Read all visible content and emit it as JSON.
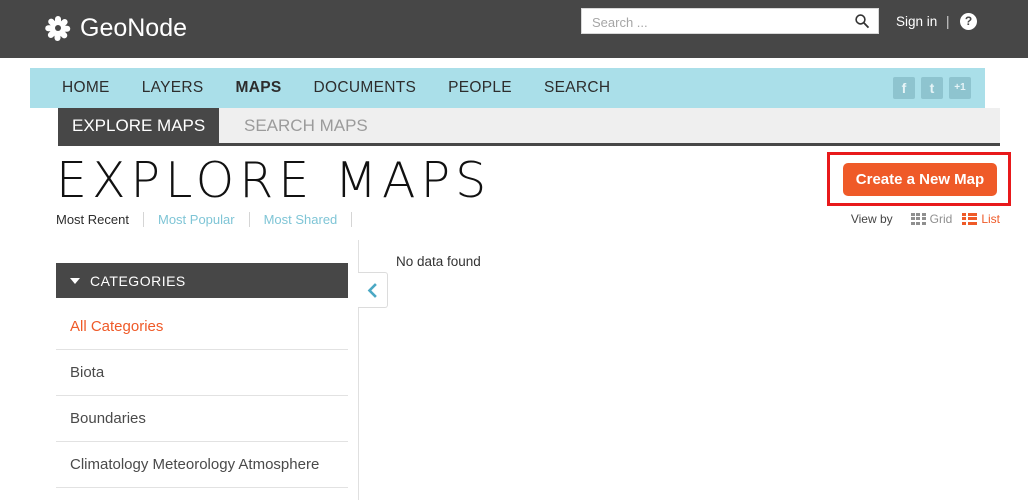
{
  "header": {
    "brand": "GeoNode",
    "brand_logo_icon": "geonode-flower-icon",
    "search": {
      "placeholder": "Search ...",
      "value": "",
      "icon": "search-icon"
    },
    "signin_label": "Sign in",
    "divider": "|",
    "help_icon_label": "?"
  },
  "nav": {
    "items": [
      {
        "label": "HOME",
        "active": false
      },
      {
        "label": "LAYERS",
        "active": false
      },
      {
        "label": "MAPS",
        "active": true
      },
      {
        "label": "DOCUMENTS",
        "active": false
      },
      {
        "label": "PEOPLE",
        "active": false
      },
      {
        "label": "SEARCH",
        "active": false
      }
    ],
    "social": [
      {
        "name": "facebook-icon",
        "glyph": "f"
      },
      {
        "name": "twitter-icon",
        "glyph": "t"
      },
      {
        "name": "google-plus-icon",
        "glyph": "+1"
      }
    ]
  },
  "tabs": [
    {
      "label": "EXPLORE MAPS",
      "active": true
    },
    {
      "label": "SEARCH MAPS",
      "active": false
    }
  ],
  "page": {
    "title": "EXPLORE MAPS",
    "sort_options": [
      {
        "label": "Most Recent",
        "active": true
      },
      {
        "label": "Most Popular",
        "active": false
      },
      {
        "label": "Most Shared",
        "active": false
      }
    ],
    "create_button": "Create a New Map",
    "view_by_label": "View by",
    "view_options": [
      {
        "label": "Grid",
        "icon": "grid-icon",
        "active": false
      },
      {
        "label": "List",
        "icon": "list-icon",
        "active": true
      }
    ]
  },
  "sidebar": {
    "header": "CATEGORIES",
    "header_icon": "chevron-down-icon",
    "items": [
      {
        "label": "All Categories",
        "active": true
      },
      {
        "label": "Biota",
        "active": false
      },
      {
        "label": "Boundaries",
        "active": false
      },
      {
        "label": "Climatology Meteorology Atmosphere",
        "active": false
      }
    ]
  },
  "main": {
    "empty_message": "No data found",
    "collapse_icon": "chevron-left-icon"
  },
  "colors": {
    "header_dark": "#474747",
    "nav_blue": "#aadfe9",
    "accent_orange": "#ef5a28",
    "link_blue": "#7fc5d6",
    "annotation_red": "#e8191b"
  }
}
